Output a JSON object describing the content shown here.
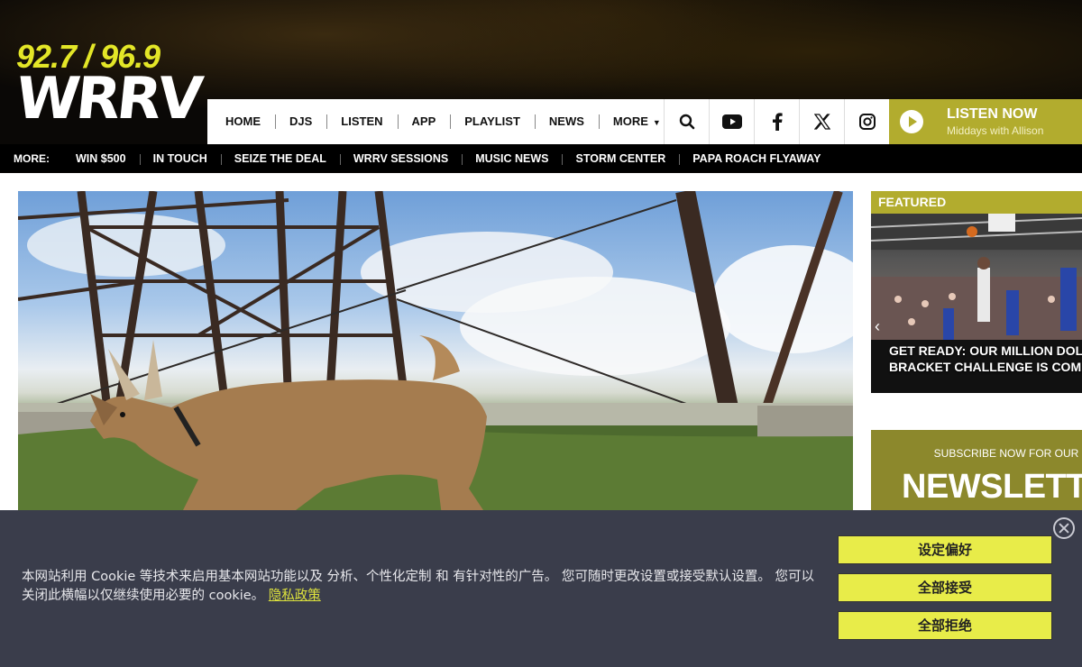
{
  "station": {
    "frequencies": "92.7 / 96.9",
    "call_letters": "WRRV"
  },
  "nav": {
    "items": [
      "HOME",
      "DJS",
      "LISTEN",
      "APP",
      "PLAYLIST",
      "NEWS",
      "MORE"
    ],
    "more_chevron": "chevron-down-icon"
  },
  "social": {
    "icons": [
      "search-icon",
      "youtube-icon",
      "facebook-icon",
      "x-icon",
      "instagram-icon"
    ]
  },
  "listen_now": {
    "label": "LISTEN NOW",
    "show": "Middays with Allison"
  },
  "more_bar": {
    "label": "MORE:",
    "items": [
      "WIN $500",
      "IN TOUCH",
      "SEIZE THE DEAL",
      "WRRV SESSIONS",
      "MUSIC NEWS",
      "STORM CENTER",
      "PAPA ROACH FLYAWAY"
    ]
  },
  "featured": {
    "heading": "FEATURED",
    "caption_line1": "GET READY: OUR MILLION DOLLAR",
    "caption_line2": "BRACKET CHALLENGE IS COMING S"
  },
  "newsletter": {
    "subtitle": "SUBSCRIBE NOW FOR OUR",
    "title": "NEWSLETTE"
  },
  "cookie": {
    "text": "本网站利用 Cookie 等技术来启用基本网站功能以及 分析、个性化定制 和 有针对性的广告。 您可随时更改设置或接受默认设置。 您可以关闭此横幅以仅继续使用必要的 cookie。",
    "privacy_link": "隐私政策",
    "btn_preferences": "设定偏好",
    "btn_accept": "全部接受",
    "btn_reject": "全部拒绝"
  },
  "colors": {
    "accent": "#b2ac2e",
    "logo_yellow": "#e3e627",
    "cookie_bg": "#3a3d4b",
    "cookie_button": "#e8ec49"
  }
}
